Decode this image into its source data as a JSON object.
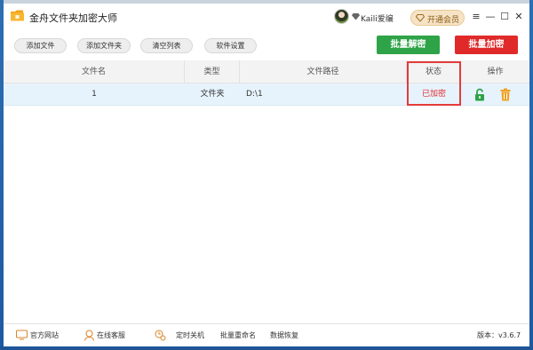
{
  "app": {
    "title": "金舟文件夹加密大师",
    "user_name": "Kaili爱编",
    "vip_label": "开通会员"
  },
  "window_controls": {
    "menu": "≡",
    "minimize": "—",
    "maximize": "☐",
    "close": "✕"
  },
  "toolbar": {
    "add_file": "添加文件",
    "add_folder": "添加文件夹",
    "clear_list": "清空列表",
    "settings": "软件设置",
    "batch_decrypt": "批量解密",
    "batch_encrypt": "批量加密"
  },
  "table": {
    "columns": [
      "文件名",
      "类型",
      "文件路径",
      "状态",
      "操作"
    ],
    "rows": [
      {
        "name": "1",
        "type": "文件夹",
        "path": "D:\\1",
        "status": "已加密"
      }
    ]
  },
  "footer": {
    "website": "官方网站",
    "support": "在线客服",
    "shutdown": "定时关机",
    "rename": "批量重命名",
    "recovery": "数据恢复",
    "version": "版本：v3.6.7"
  },
  "colors": {
    "decrypt_green": "#2ea348",
    "encrypt_red": "#e02a2a",
    "status_red": "#e02a2a",
    "highlight_border": "#e33b3b",
    "row_selected": "#e7f3fc",
    "unlock_green": "#2ea348",
    "trash_orange": "#f0a020"
  },
  "icons": [
    "folder-app-icon",
    "avatar",
    "diamond-icon",
    "monitor-icon",
    "headset-icon",
    "clock-gear-icon",
    "unlock-icon",
    "trash-icon"
  ]
}
